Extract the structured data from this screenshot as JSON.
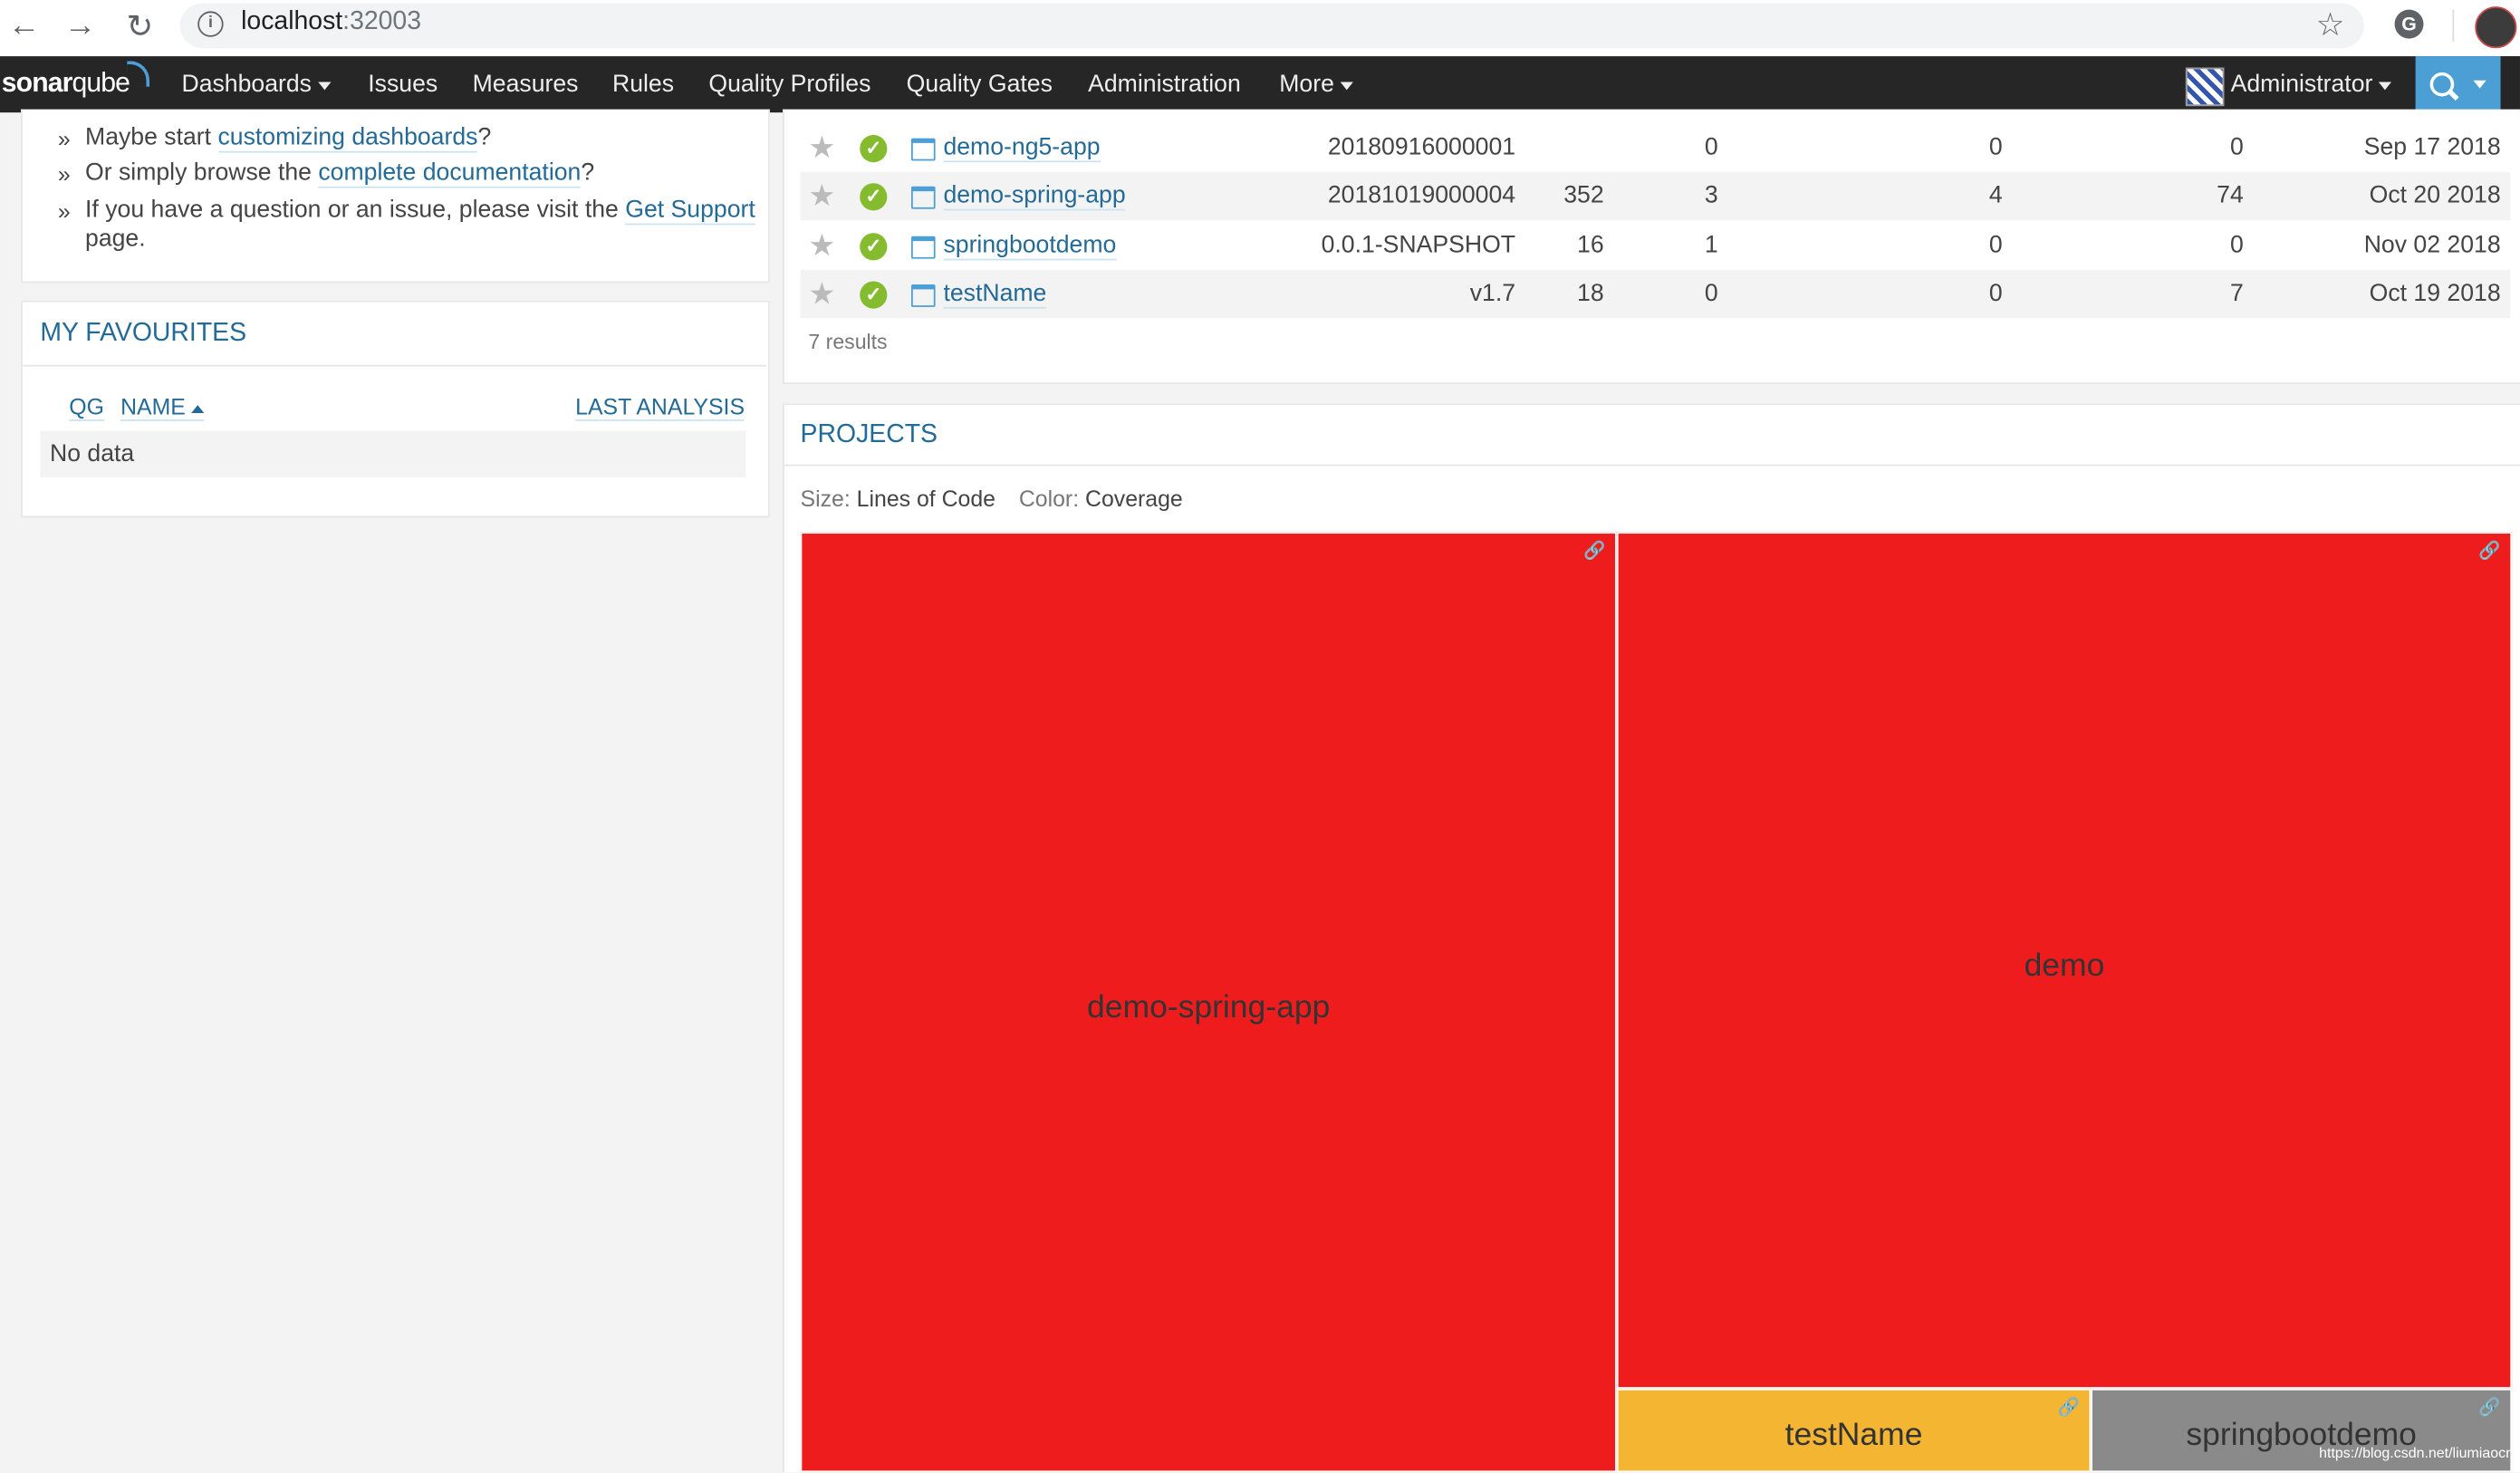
{
  "browser": {
    "url_host": "localhost",
    "url_port": ":32003"
  },
  "nav": {
    "logo_bold": "sonar",
    "logo_light": "qube",
    "items": [
      "Dashboards",
      "Issues",
      "Measures",
      "Rules",
      "Quality Profiles",
      "Quality Gates",
      "Administration",
      "More"
    ],
    "user": "Administrator"
  },
  "about": {
    "line1_pre": "Maybe start ",
    "line1_link": "customizing dashboards",
    "line1_post": "?",
    "line2_pre": "Or simply browse the ",
    "line2_link": "complete documentation",
    "line2_post": "?",
    "line3_pre": "If you have a question or an issue, please visit the ",
    "line3_link": "Get Support",
    "line3_cont": "page."
  },
  "favourites": {
    "title": "MY FAVOURITES",
    "col_qg": "QG",
    "col_name": "NAME",
    "col_last": "LAST ANALYSIS",
    "empty": "No data"
  },
  "projects_table": {
    "rows": [
      {
        "name": "demo-ng5-app",
        "version": "20180916000001",
        "loc": "",
        "bugs": "0",
        "vulns": "0",
        "smells": "0",
        "date": "Sep 17 2018"
      },
      {
        "name": "demo-spring-app",
        "version": "20181019000004",
        "loc": "352",
        "bugs": "3",
        "vulns": "4",
        "smells": "74",
        "date": "Oct 20 2018"
      },
      {
        "name": "springbootdemo",
        "version": "0.0.1-SNAPSHOT",
        "loc": "16",
        "bugs": "1",
        "vulns": "0",
        "smells": "0",
        "date": "Nov 02 2018"
      },
      {
        "name": "testName",
        "version": "v1.7",
        "loc": "18",
        "bugs": "0",
        "vulns": "0",
        "smells": "7",
        "date": "Oct 19 2018"
      }
    ],
    "results": "7 results"
  },
  "projects": {
    "title": "PROJECTS",
    "size_label": "Size:",
    "size_value": "Lines of Code",
    "color_label": "Color:",
    "color_value": "Coverage",
    "tiles": [
      {
        "name": "demo-spring-app",
        "color": "#ee1c1c"
      },
      {
        "name": "demo",
        "color": "#ee1c1c"
      },
      {
        "name": "testName",
        "color": "#f4b532"
      },
      {
        "name": "springbootdemo",
        "color": "#8a8a8a"
      }
    ]
  },
  "watermark": "https://blog.csdn.net/liumiaocn"
}
